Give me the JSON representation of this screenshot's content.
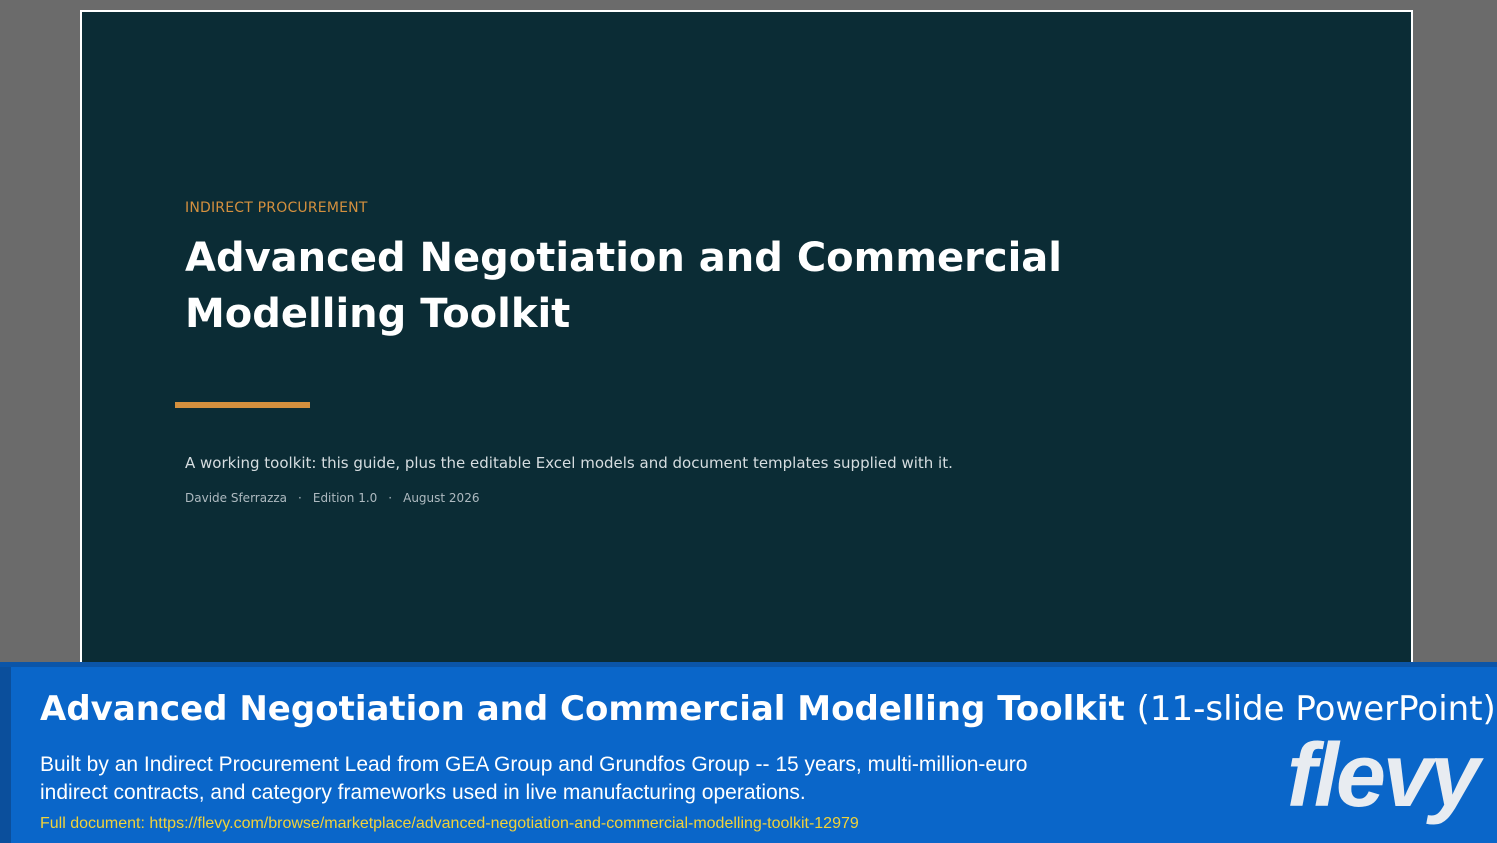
{
  "slide": {
    "eyebrow": "INDIRECT PROCUREMENT",
    "title": "Advanced Negotiation and Commercial Modelling Toolkit",
    "subtitle": "A working toolkit: this guide, plus the editable Excel models and document templates supplied with it.",
    "author": "Davide Sferrazza",
    "separator": "·",
    "edition": "Edition 1.0",
    "date": "August 2026"
  },
  "banner": {
    "title": "Advanced Negotiation and Commercial Modelling Toolkit",
    "title_suffix": "(11-slide PowerPoint)",
    "description": "Built by an Indirect Procurement Lead from GEA Group and Grundfos Group -- 15 years, multi-million-euro indirect contracts, and category frameworks used in live manufacturing operations.",
    "link": "Full document: https://flevy.com/browse/marketplace/advanced-negotiation-and-commercial-modelling-toolkit-12979",
    "logo": "flevy"
  },
  "colors": {
    "slide_background": "#0b2c35",
    "accent": "#d4903e",
    "banner_background": "#0a66c9",
    "link": "#f1d23a"
  }
}
